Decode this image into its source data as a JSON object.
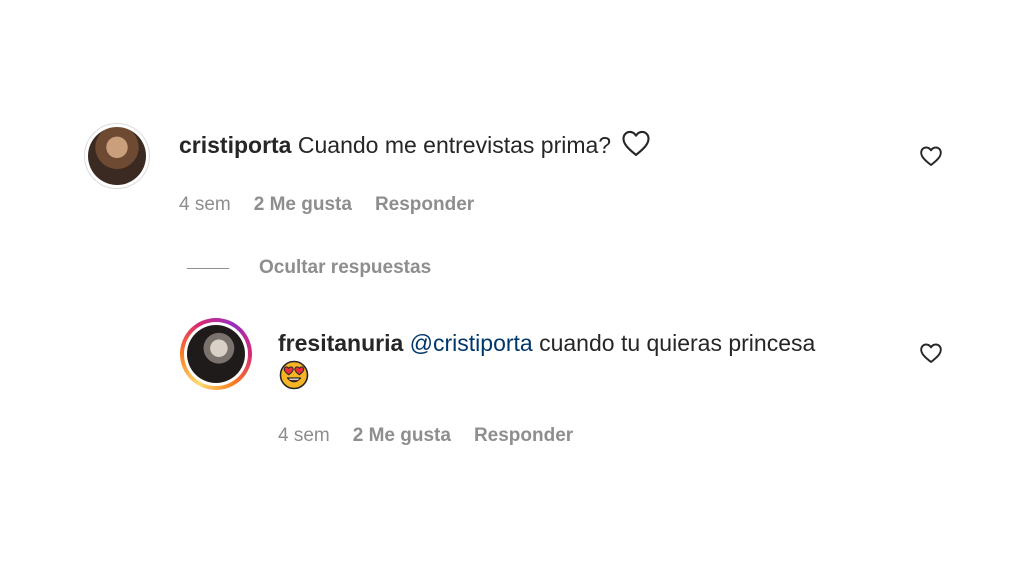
{
  "comment": {
    "username": "cristiporta",
    "text": "Cuando me entrevistas prima?",
    "inline_icon": "heart-outline-icon",
    "time": "4 sem",
    "likes": "2 Me gusta",
    "reply_label": "Responder",
    "like_icon": "heart-outline-icon"
  },
  "replies_toggle": {
    "label": "Ocultar respuestas"
  },
  "reply": {
    "username": "fresitanuria",
    "mention": "@cristiporta",
    "text": "cuando tu quieras princesa",
    "emoji": "heart-eyes-emoji",
    "time": "4 sem",
    "likes": "2 Me gusta",
    "reply_label": "Responder",
    "like_icon": "heart-outline-icon"
  },
  "colors": {
    "text": "#262626",
    "muted": "#8e8e8e",
    "mention": "#00376b"
  }
}
